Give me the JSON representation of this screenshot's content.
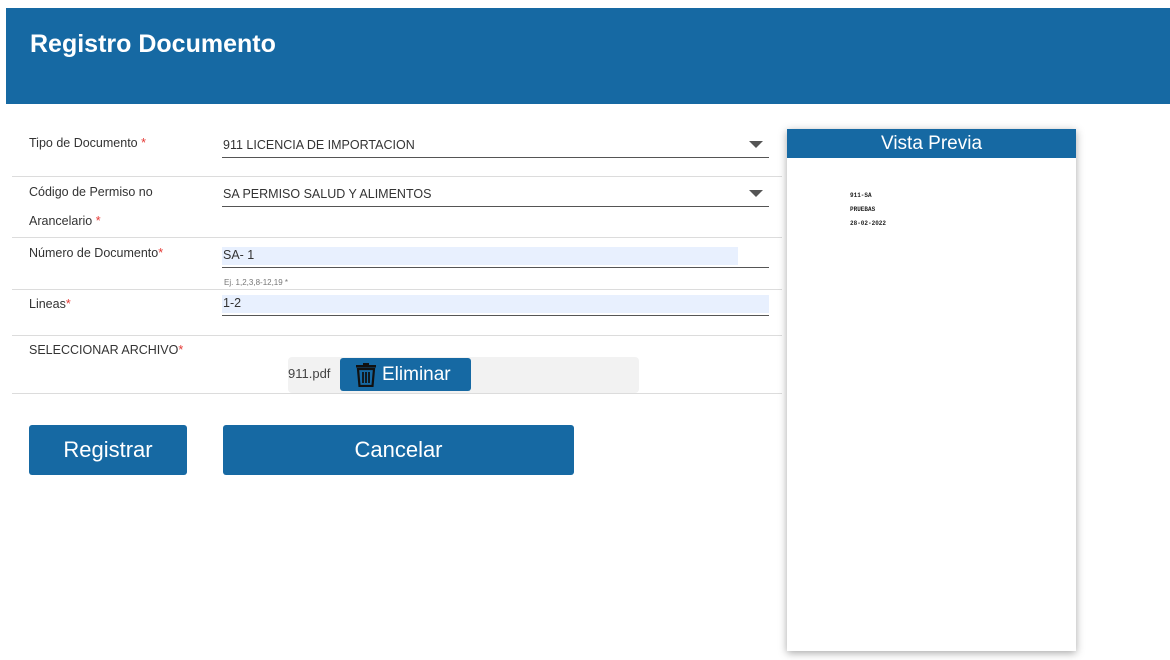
{
  "header": {
    "title": "Registro Documento"
  },
  "form": {
    "tipo_documento": {
      "label": "Tipo de Documento",
      "required_mark": "*",
      "value": "911 LICENCIA DE IMPORTACION"
    },
    "codigo_permiso": {
      "label_line1": "Código de Permiso no",
      "label_line2": "Arancelario",
      "required_mark": "*",
      "value": "SA PERMISO SALUD Y ALIMENTOS"
    },
    "numero_documento": {
      "label": "Número de Documento",
      "required_mark": "*",
      "value": "SA- 1",
      "hint": "Ej. 1,2,3,8-12,19 *"
    },
    "lineas": {
      "label": "Lineas",
      "required_mark": "*",
      "value": "1-2"
    },
    "archivo": {
      "label": "SELECCIONAR ARCHIVO",
      "required_mark": "*",
      "file_name": "911.pdf",
      "delete_label": "Eliminar"
    }
  },
  "actions": {
    "register_label": "Registrar",
    "cancel_label": "Cancelar"
  },
  "preview": {
    "title": "Vista Previa",
    "lines": [
      "911-SA",
      "PRUEBAS",
      "28-02-2022"
    ]
  },
  "colors": {
    "primary": "#1669a3",
    "required": "#e53935",
    "input_fill": "#e8f0fe"
  },
  "icons": {
    "caret": "chevron-down-icon",
    "delete": "trash-icon"
  }
}
